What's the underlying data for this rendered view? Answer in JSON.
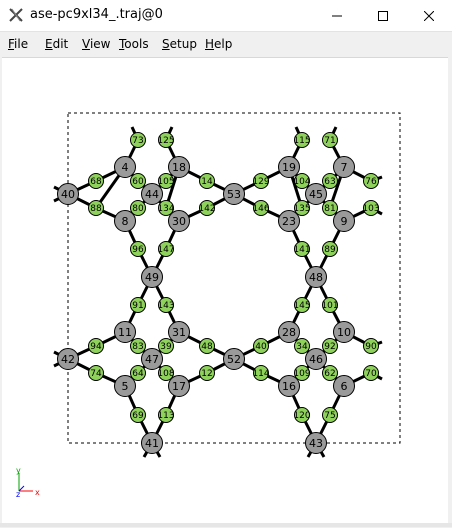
{
  "window": {
    "title": "ase-pc9xl34_.traj@0",
    "controls": {
      "minimize": "minimize-icon",
      "maximize": "maximize-icon",
      "close": "close-icon"
    }
  },
  "menu": {
    "items": [
      {
        "label": "File",
        "key": "F"
      },
      {
        "label": "Edit",
        "key": "E"
      },
      {
        "label": "View",
        "key": "V"
      },
      {
        "label": "Tools",
        "key": "T"
      },
      {
        "label": "Setup",
        "key": "S"
      },
      {
        "label": "Help",
        "key": "H"
      }
    ]
  },
  "colors": {
    "atom_gray": "#9a9a9a",
    "atom_green": "#8fd25b",
    "bond": "#000000",
    "axis_x": "#ff0000",
    "axis_y": "#00a000",
    "axis_z": "#0000ff"
  },
  "viewer": {
    "gray_atoms": [
      "4",
      "18",
      "19",
      "7",
      "40",
      "44",
      "53",
      "45",
      "8",
      "30",
      "23",
      "9",
      "49",
      "48",
      "11",
      "31",
      "28",
      "10",
      "42",
      "47",
      "52",
      "46",
      "5",
      "17",
      "16",
      "6",
      "41",
      "43"
    ],
    "green_atoms": [
      "73",
      "125",
      "115",
      "71",
      "68",
      "60",
      "105",
      "14",
      "129",
      "104",
      "63",
      "76",
      "88",
      "80",
      "134",
      "142",
      "146",
      "135",
      "81",
      "103",
      "96",
      "147",
      "141",
      "89",
      "91",
      "143",
      "145",
      "101",
      "94",
      "83",
      "39",
      "48",
      "40",
      "34",
      "92",
      "90",
      "74",
      "64",
      "108",
      "12",
      "114",
      "109",
      "62",
      "70",
      "69",
      "113",
      "120",
      "75"
    ],
    "axes": {
      "x": "x",
      "y": "y",
      "z": "z"
    }
  }
}
